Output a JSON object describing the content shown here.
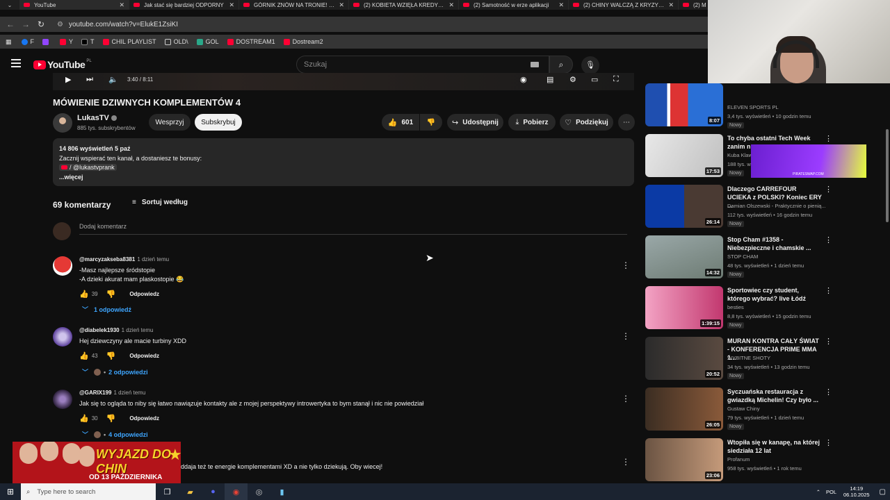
{
  "browser": {
    "tabs": [
      {
        "title": "YouTube",
        "active": true
      },
      {
        "title": "Jak stać się bardziej ODPORNY"
      },
      {
        "title": "GÓRNIK ZNÓW NA TRONIE! SP"
      },
      {
        "title": "(2) KOBIETA WZIĘŁA KREDYT W"
      },
      {
        "title": "(2) Samotność w erze aplikacji"
      },
      {
        "title": "(2) CHINY WALCZĄ Z KRYZYSE"
      },
      {
        "title": "(2) M"
      }
    ],
    "url": "youtube.com/watch?v=ElukE1ZsiKI",
    "bookmarks": [
      "F",
      "",
      "Y",
      "T",
      "CHIL PLAYLIST",
      "OLD\\",
      "GOL",
      "DOSTREAM1",
      "Dostream2"
    ]
  },
  "header": {
    "logo": "YouTube",
    "logo_country": "PL",
    "search_placeholder": "Szukaj"
  },
  "player": {
    "time": "3:40 / 8:11"
  },
  "video": {
    "title": "MÓWIENIE DZIWNYCH KOMPLEMENTÓW 4",
    "channel": "LukasTV",
    "subscribers": "885 tys. subskrybentów",
    "support_label": "Wesprzyj",
    "subscribe_label": "Subskrybuj",
    "likes": "601",
    "share_label": "Udostępnij",
    "download_label": "Pobierz",
    "thanks_label": "Podziękuj"
  },
  "description": {
    "stats": "14 806 wyświetleń  5 paź",
    "line1": "Zacznij wspierać ten kanał, a dostaniesz te bonusy:",
    "link": "/ @lukastvprank",
    "more": "...więcej"
  },
  "comments": {
    "count": "69 komentarzy",
    "sort_label": "Sortuj według",
    "add_placeholder": "Dodaj komentarz",
    "reply_label": "Odpowiedz",
    "items": [
      {
        "user": "@marcyzakseba8381",
        "date": "1 dzień temu",
        "lines": [
          "-Masz najlepsze śródstopie",
          "-A dzieki akurat mam plaskostopie 😂"
        ],
        "likes": "39",
        "replies": "1 odpowiedź"
      },
      {
        "user": "@diabelek1930",
        "date": "1 dzień temu",
        "lines": [
          "Hej dziewczyny ale macie turbiny XDD"
        ],
        "likes": "43",
        "replies": "2 odpowiedzi"
      },
      {
        "user": "@GARIX199",
        "date": "1 dzień temu",
        "lines": [
          "Jak się to ogląda to niby się łatwo nawiązuje kontakty ale z mojej perspektywy introwertyka to bym stanął i nic nie powiedział"
        ],
        "likes": "30",
        "replies": "4 odpowiedzi"
      },
      {
        "lines": [
          "ddaja też te energie komplementami XD a nie tylko dziekują. Oby wiecej!"
        ]
      }
    ]
  },
  "sidebar": [
    {
      "title": "",
      "channel": "ELEVEN SPORTS PL",
      "meta": "3,4 tys. wyświetleń • 10 godzin temu",
      "badge": "Nowy",
      "duration": "8:07"
    },
    {
      "title": "To chyba ostatni Tech Week zanim n",
      "channel": "Kuba Klaw",
      "meta": "188 tys. w",
      "badge": "Nowy",
      "duration": "17:53"
    },
    {
      "title": "Dlaczego CARREFOUR UCIEKA z POLSKI? Koniec ERY ...",
      "channel": "Damian Olszewski - Praktycznie o pienią...",
      "meta": "112 tys. wyświetleń • 16 godzin temu",
      "badge": "Nowy",
      "duration": "26:14"
    },
    {
      "title": "Stop Cham #1358 - Niebezpieczne i chamskie ...",
      "channel": "STOP CHAM",
      "meta": "48 tys. wyświetleń • 1 dzień temu",
      "badge": "Nowy",
      "duration": "14:32"
    },
    {
      "title": "Sportowiec czy student, którego wybrać? live Łódź",
      "channel": "besties",
      "meta": "8,8 tys. wyświetleń • 15 godzin temu",
      "badge": "Nowy",
      "duration": "1:39:15"
    },
    {
      "title": "MURAN KONTRA CAŁY ŚWIAT - KONFERENCJA PRIME MMA 1...",
      "channel": "WYBITNE SHOTY",
      "meta": "34 tys. wyświetleń • 13 godzin temu",
      "badge": "Nowy",
      "duration": "20:52"
    },
    {
      "title": "Syczuańska restauracja z gwiazdką Michelin! Czy było ...",
      "channel": "Gustaw Chiny",
      "meta": "79 tys. wyświetleń • 1 dzień temu",
      "badge": "Nowy",
      "duration": "26:05"
    },
    {
      "title": "Wtopiła się w kanapę, na której siedziała 12 lat",
      "channel": "Profanum",
      "meta": "958 tys. wyświetleń • 1 rok temu",
      "badge": "",
      "duration": "23:06"
    }
  ],
  "promo": {
    "title": "WYJAZD DO CHIN",
    "date": "OD 13 PAŹDZIERNIKA"
  },
  "taskbar": {
    "search_placeholder": "Type here to search",
    "lang": "POL",
    "time": "14:19",
    "date": "06.10.2025"
  }
}
